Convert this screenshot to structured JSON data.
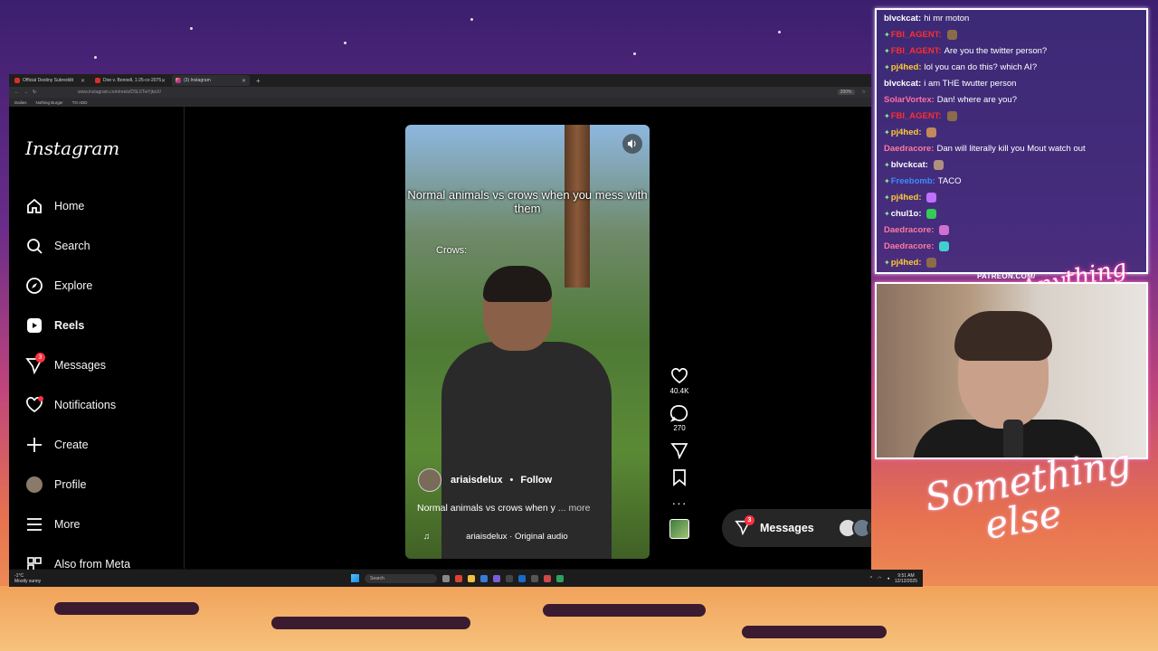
{
  "browser": {
    "tabs": [
      {
        "label": "Official Destiny Subreddit"
      },
      {
        "label": "Doe v. Bonnell, 1:25-cv-20757"
      },
      {
        "label": "(3) Instagram"
      }
    ],
    "new_tab": "+",
    "url": "www.instagram.com/reels/DSL6TwYjboX/",
    "zoom": "200%",
    "bookmarks": [
      "Dailies",
      "Nothing Burger",
      "TO ADD"
    ]
  },
  "instagram": {
    "logo": "Instagram",
    "nav": [
      {
        "label": "Home",
        "icon": "home-icon"
      },
      {
        "label": "Search",
        "icon": "search-icon"
      },
      {
        "label": "Explore",
        "icon": "compass-icon"
      },
      {
        "label": "Reels",
        "icon": "reels-icon"
      },
      {
        "label": "Messages",
        "icon": "messenger-icon",
        "badge": "3"
      },
      {
        "label": "Notifications",
        "icon": "heart-icon"
      },
      {
        "label": "Create",
        "icon": "plus-icon"
      },
      {
        "label": "Profile",
        "icon": "avatar-icon"
      },
      {
        "label": "More",
        "icon": "menu-icon"
      },
      {
        "label": "Also from Meta",
        "icon": "meta-icon"
      }
    ],
    "reel": {
      "overlay_text": "Normal animals vs crows when you mess with them",
      "overlay_label": "Crows:",
      "username": "ariaisdelux",
      "separator": "•",
      "follow": "Follow",
      "caption": "Normal animals vs crows when y",
      "caption_more": "... more",
      "audio": "ariaisdelux · Original audio"
    },
    "actions": {
      "likes": "40.4K",
      "comments": "270"
    },
    "messages_pill": {
      "label": "Messages",
      "badge": "3"
    }
  },
  "taskbar": {
    "weather_temp": "-1°C",
    "weather_desc": "Mostly sunny",
    "search_placeholder": "Search",
    "time": "9:51 AM",
    "date": "12/12/2025"
  },
  "chat": {
    "messages": [
      {
        "user": "blvckcat:",
        "text": "hi mr moton",
        "color": "#ffffff",
        "gem": false
      },
      {
        "user": "FBI_AGENT:",
        "text": "",
        "color": "#ff2d2d",
        "gem": true,
        "emote": "#8b6b4a"
      },
      {
        "user": "FBI_AGENT:",
        "text": "Are you the twitter person?",
        "color": "#ff2d2d",
        "gem": true
      },
      {
        "user": "pj4hed:",
        "text": "lol you can do this? which AI?",
        "color": "#ffcc33",
        "gem": true
      },
      {
        "user": "blvckcat:",
        "text": "i am THE twutter person",
        "color": "#ffffff",
        "gem": false
      },
      {
        "user": "SolarVortex:",
        "text": "Dan! where are you?",
        "color": "#ff6fa0",
        "gem": false
      },
      {
        "user": "FBI_AGENT:",
        "text": "",
        "color": "#ff2d2d",
        "gem": true,
        "emote": "#8b6b4a"
      },
      {
        "user": "pj4hed:",
        "text": "",
        "color": "#ffcc33",
        "gem": true,
        "emote": "#c08a5a"
      },
      {
        "user": "Daedracore:",
        "text": "Dan will literally kill you Mout watch out",
        "color": "#ff7aa0",
        "gem": false
      },
      {
        "user": "blvckcat:",
        "text": "",
        "color": "#ffffff",
        "gem": true,
        "emote": "#b09080"
      },
      {
        "user": "Freebomb:",
        "text": "TACO",
        "color": "#3b8cff",
        "gem": true
      },
      {
        "user": "pj4hed:",
        "text": "",
        "color": "#ffcc33",
        "gem": true,
        "emote": "#c070ff"
      },
      {
        "user": "chul1o:",
        "text": "",
        "color": "#ffffff",
        "gem": true,
        "emote": "#33cc55"
      },
      {
        "user": "Daedracore:",
        "text": "",
        "color": "#ff7aa0",
        "gem": false,
        "emote": "#d070d0"
      },
      {
        "user": "Daedracore:",
        "text": "",
        "color": "#ff7aa0",
        "gem": false,
        "emote": "#40d0d0"
      },
      {
        "user": "pj4hed:",
        "text": "",
        "color": "#ffcc33",
        "gem": true,
        "emote": "#8b6b4a"
      }
    ]
  },
  "overlay": {
    "patreon": "PATREON.COM/",
    "anything_else": "Anything else",
    "something_else_1": "Something",
    "something_else_2": "else"
  }
}
